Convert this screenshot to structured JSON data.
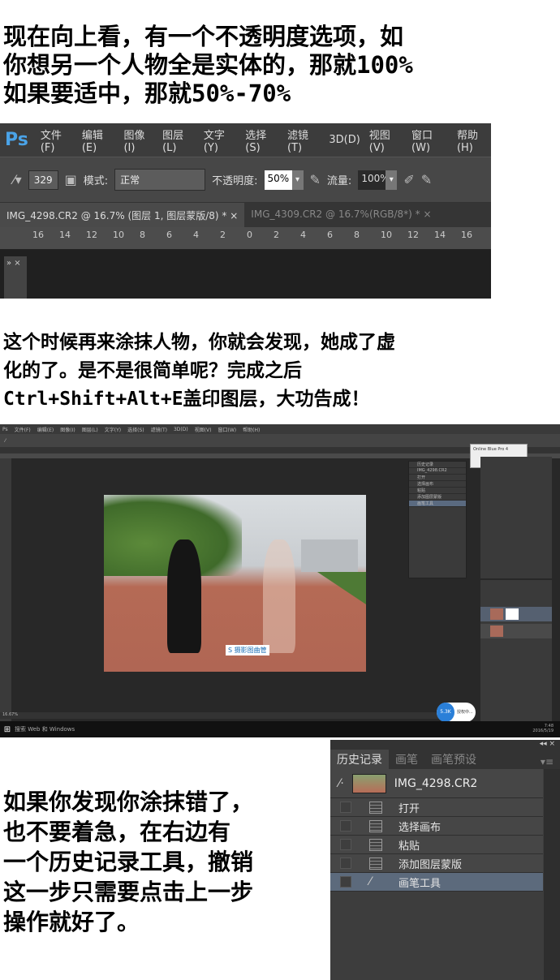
{
  "intro_text": {
    "lines": [
      "现在向上看，有一个不透明度选项，如",
      "你想另一个人物全是实体的，那就100%",
      "如果要适中，那就50%-70%"
    ]
  },
  "screenshot1": {
    "logo": "Ps",
    "menu": [
      "文件(F)",
      "编辑(E)",
      "图像(I)",
      "图层(L)",
      "文字(Y)",
      "选择(S)",
      "滤镜(T)",
      "3D(D)",
      "视图(V)",
      "窗口(W)",
      "帮助(H)"
    ],
    "toolbar": {
      "brush_size": "329",
      "mode_label": "模式:",
      "mode_value": "正常",
      "opacity_label": "不透明度:",
      "opacity_value": "50%",
      "flow_label": "流量:",
      "flow_value": "100%"
    },
    "tabs": [
      {
        "label": "IMG_4298.CR2 @ 16.7% (图层 1, 图层蒙版/8) *",
        "close": "×"
      },
      {
        "label": "IMG_4309.CR2 @ 16.7%(RGB/8*) *",
        "close": "×"
      }
    ],
    "ruler": [
      "16",
      "14",
      "12",
      "10",
      "8",
      "6",
      "4",
      "2",
      "0",
      "2",
      "4",
      "6",
      "8",
      "10",
      "12",
      "14",
      "16"
    ],
    "mini_panel": "» ×"
  },
  "middle_text": {
    "lines": [
      "这个时候再来涂抹人物，你就会发现，她成了虚",
      "化的了。是不是很简单呢？完成之后",
      "Ctrl+Shift+Alt+E盖印图层，大功告成！"
    ]
  },
  "screenshot2": {
    "menu": [
      "Ps",
      "文件(F)",
      "编辑(E)",
      "图像(I)",
      "图层(L)",
      "文字(Y)",
      "选择(S)",
      "滤镜(T)",
      "3D(D)",
      "视图(V)",
      "窗口(W)",
      "帮助(H)"
    ],
    "popup": "Online Blue Pro 4",
    "history_title": "历史记录",
    "history": [
      "IMG_4298.CR2",
      "打开",
      "选择画布",
      "粘贴",
      "添加图层蒙版",
      "画笔工具"
    ],
    "watermark": "S 摄影图曲管",
    "status": "16.67%",
    "bubble": "5.3K",
    "bubble_text": "授权中...",
    "taskbar_search": "搜索 Web 和 Windows",
    "clock_time": "7:48",
    "clock_date": "2016/5/19"
  },
  "bottom_text": {
    "lines": [
      "如果你发现你涂抹错了，",
      "也不要着急，在右边有",
      "一个历史记录工具，撤销",
      "这一步只需要点击上一步",
      "操作就好了。"
    ]
  },
  "history_panel": {
    "controls": "◂◂  ×",
    "tabs": [
      "历史记录",
      "画笔",
      "画笔预设"
    ],
    "menu_icon": "▾≡",
    "snapshot": "IMG_4298.CR2",
    "items": [
      "打开",
      "选择画布",
      "粘贴",
      "添加图层蒙版",
      "画笔工具"
    ],
    "selected": "画笔工具"
  }
}
